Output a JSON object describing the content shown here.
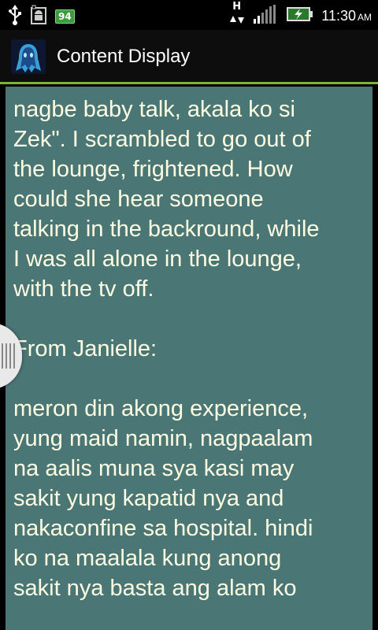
{
  "status_bar": {
    "battery_level": "94",
    "network_indicator": "H",
    "time": "11:30",
    "ampm": "AM",
    "icons": [
      "usb-icon",
      "android-debug-icon",
      "battery-badge",
      "data-arrows-icon",
      "signal-bars-icon",
      "battery-charging-icon"
    ]
  },
  "title_bar": {
    "title": "Content Display",
    "icon": "ghost-icon",
    "accent_color": "#7ab23a"
  },
  "content": {
    "background_color": "#4a7676",
    "text_color": "#fffde1",
    "lines": [
      "nagbe baby talk, akala ko si",
      "Zek\". I scrambled to go out of",
      "the lounge, frightened. How",
      "could she hear someone",
      "talking in the backround, while",
      "I was all alone in the lounge,",
      "with the tv off."
    ],
    "section_heading": "From Janielle:",
    "lines2": [
      "meron din akong experience,",
      "yung maid namin, nagpaalam",
      "na aalis muna sya kasi may",
      "sakit yung kapatid nya and",
      "nakaconfine sa hospital. hindi",
      "ko na maalala kung anong",
      "sakit nya basta ang alam ko"
    ]
  },
  "scroll_handle": {
    "icon": "grip-lines-icon"
  }
}
